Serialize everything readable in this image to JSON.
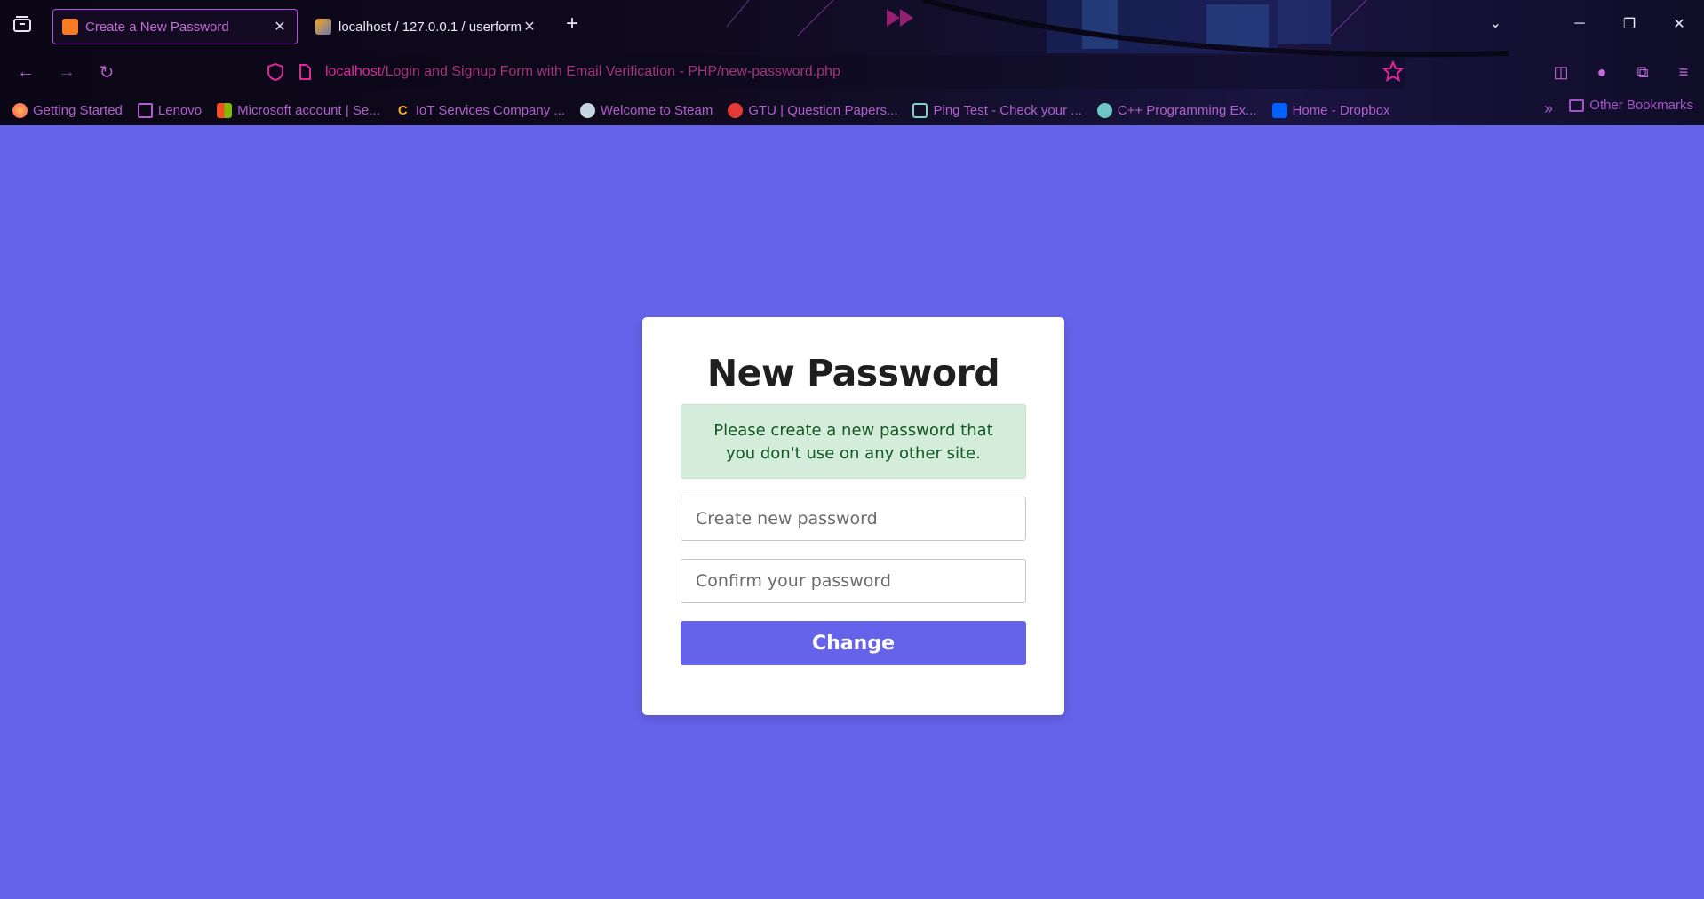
{
  "browser": {
    "tabs": [
      {
        "title": "Create a New Password",
        "active": true,
        "favicon": "xampp-icon"
      },
      {
        "title": "localhost / 127.0.0.1 / userform",
        "active": false,
        "favicon": "phpmyadmin-icon"
      }
    ],
    "new_tab_symbol": "+",
    "url": {
      "host": "localhost",
      "path": "/Login and Signup Form with Email Verification - PHP/new-password.php"
    },
    "bookmarks": [
      {
        "label": "Getting Started",
        "icon": "firefox-icon",
        "color": "#ff7139"
      },
      {
        "label": "Lenovo",
        "icon": "folder-icon",
        "color": "#b05fcc"
      },
      {
        "label": "Microsoft account | Se...",
        "icon": "microsoft-icon",
        "color": "#f25022"
      },
      {
        "label": "IoT Services Company ...",
        "icon": "c-logo-icon",
        "color": "#f2b01e"
      },
      {
        "label": "Welcome to Steam",
        "icon": "steam-icon",
        "color": "#c7d5e0"
      },
      {
        "label": "GTU | Question Papers...",
        "icon": "gtu-icon",
        "color": "#e53935"
      },
      {
        "label": "Ping Test - Check your ...",
        "icon": "chip-icon",
        "color": "#7fd1c9"
      },
      {
        "label": "C++ Programming Ex...",
        "icon": "cpp-icon",
        "color": "#6ec6c6"
      },
      {
        "label": "Home - Dropbox",
        "icon": "dropbox-icon",
        "color": "#0061fe"
      }
    ],
    "other_bookmarks": "Other Bookmarks"
  },
  "page": {
    "background": "#6563ea",
    "title": "New Password",
    "alert": "Please create a new password that you don't use on any other site.",
    "new_password_placeholder": "Create new password",
    "confirm_password_placeholder": "Confirm your password",
    "submit_label": "Change"
  }
}
